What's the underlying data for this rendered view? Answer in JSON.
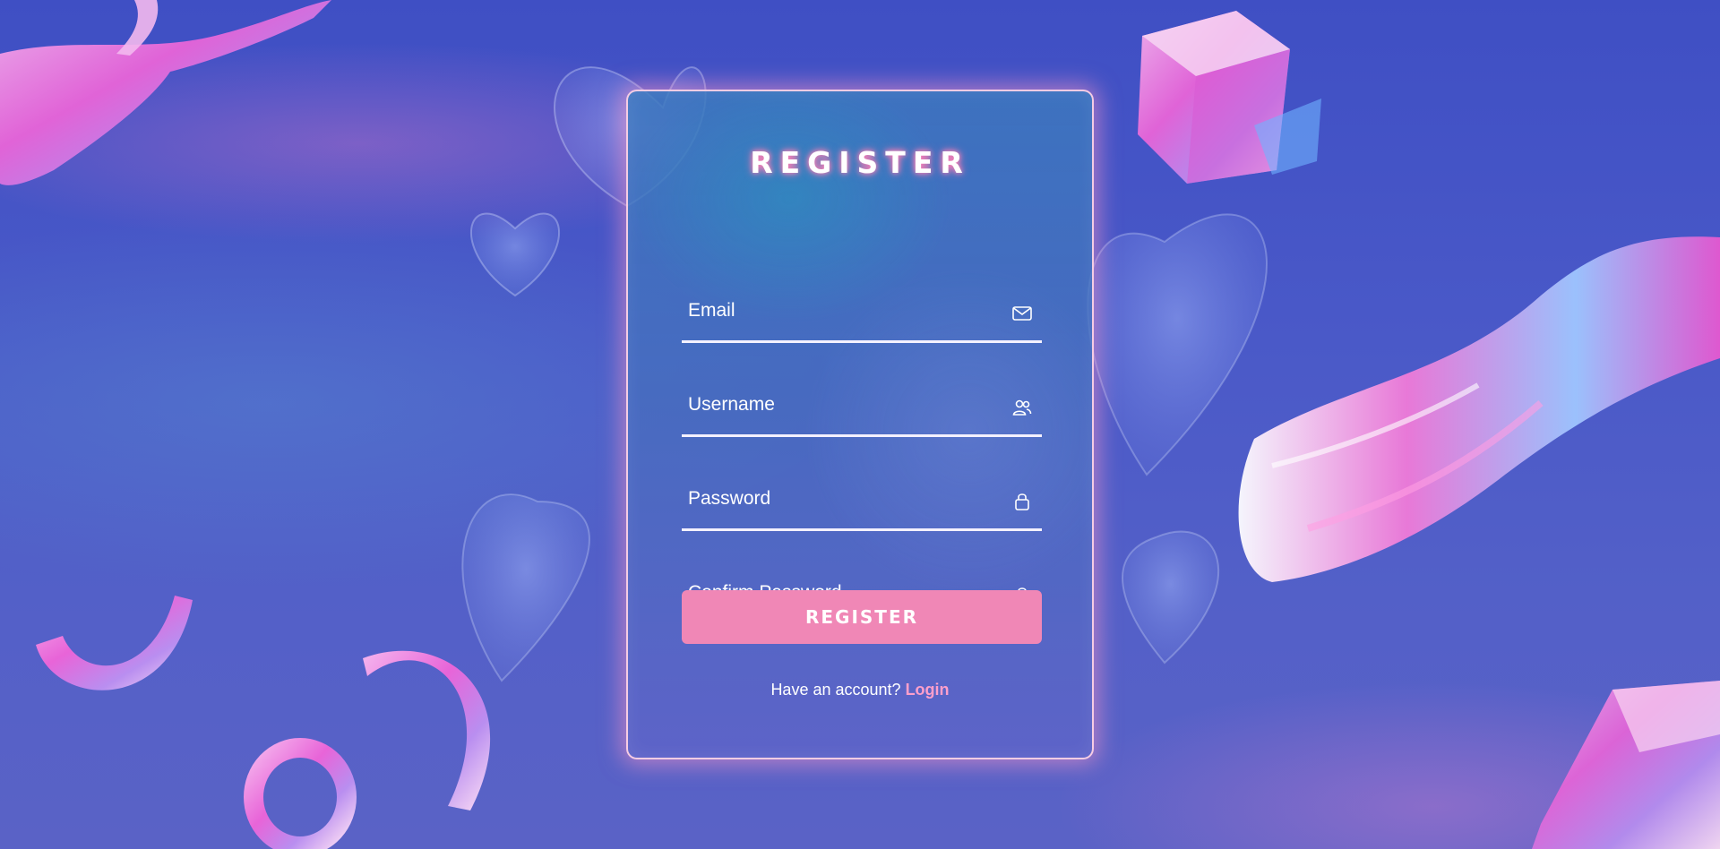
{
  "register_form": {
    "title": "REGISTER",
    "fields": [
      {
        "placeholder": "Email",
        "icon": "envelope-icon"
      },
      {
        "placeholder": "Username",
        "icon": "users-icon"
      },
      {
        "placeholder": "Password",
        "icon": "lock-icon"
      },
      {
        "placeholder": "Confirm Password",
        "icon": "lock-icon"
      }
    ],
    "submit_label": "REGISTER",
    "footer_prompt": "Have an account?",
    "login_link": "Login"
  },
  "colors": {
    "background": "#4a57c2",
    "accent_pink": "#f087b6",
    "link_pink": "#ff9fcb",
    "card_border": "#ffd2e6",
    "text": "#ffffff"
  }
}
